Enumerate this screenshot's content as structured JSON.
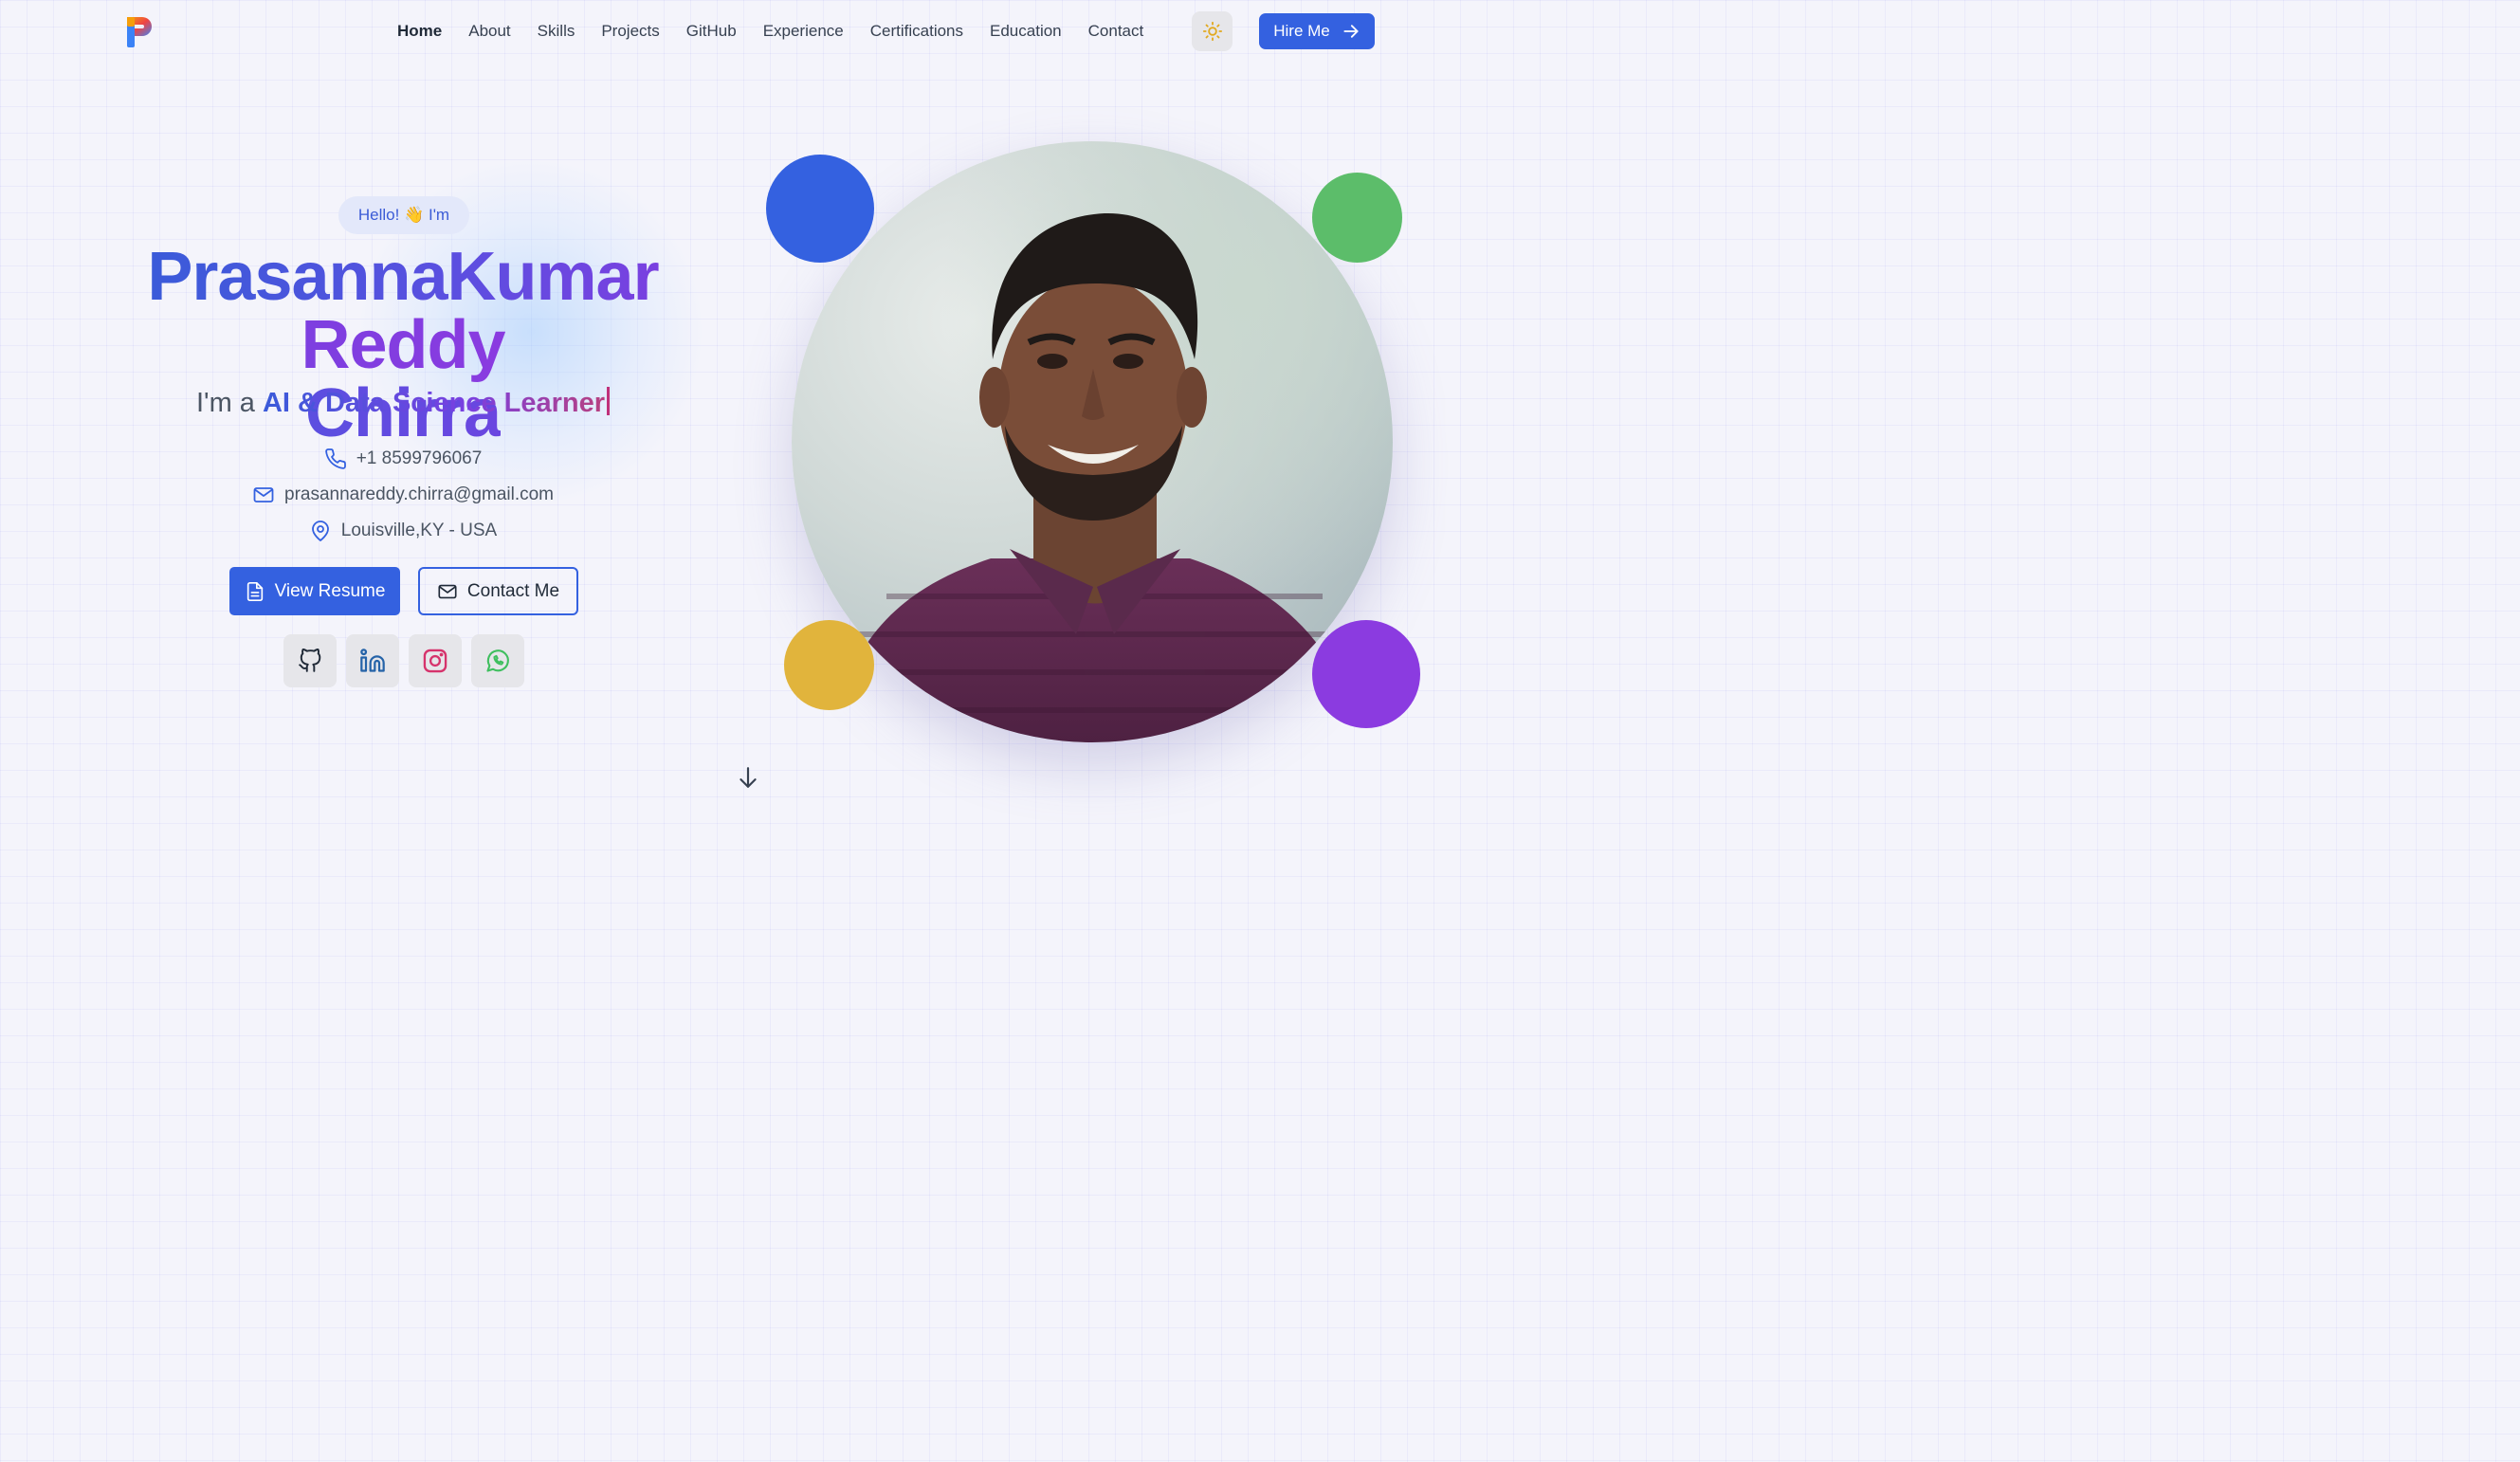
{
  "header": {
    "logo_letter": "P",
    "nav": [
      {
        "label": "Home",
        "active": true
      },
      {
        "label": "About"
      },
      {
        "label": "Skills"
      },
      {
        "label": "Projects"
      },
      {
        "label": "GitHub"
      },
      {
        "label": "Experience"
      },
      {
        "label": "Certifications"
      },
      {
        "label": "Education"
      },
      {
        "label": "Contact"
      }
    ],
    "theme_icon": "sun-icon",
    "hire_label": "Hire Me"
  },
  "hero": {
    "greeting": "Hello! 👋 I'm",
    "name_part1": "PrasannaKumar",
    "name_part2": "Reddy",
    "name_part3": "Chirra",
    "role_prefix": "I'm a",
    "role_highlight": "AI & Data Science Learner",
    "phone": "+1 8599796067",
    "email": "prasannareddy.chirra@gmail.com",
    "location": "Louisville,KY - USA",
    "resume_label": "View Resume",
    "contact_label": "Contact Me",
    "socials": [
      "github-icon",
      "linkedin-icon",
      "instagram-icon",
      "whatsapp-icon"
    ]
  },
  "colors": {
    "primary": "#3461e0",
    "dot_blue": "#3461e0",
    "dot_green": "#5cbd6a",
    "dot_yellow": "#e1b43c",
    "dot_purple": "#8b3be0"
  }
}
